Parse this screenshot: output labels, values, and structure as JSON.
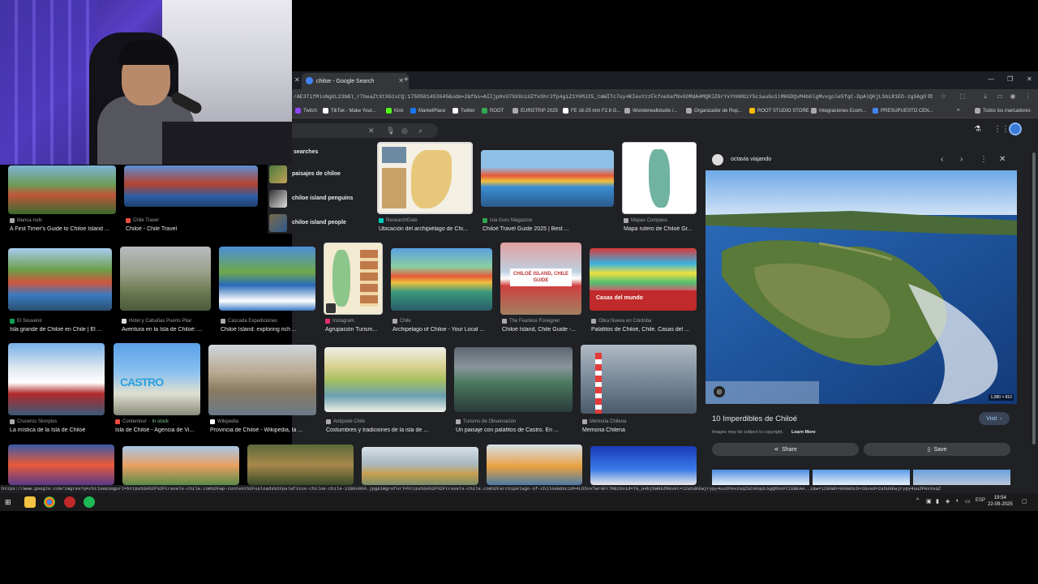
{
  "browser": {
    "tab_title": "chiloe - Google Search",
    "url": "/AE3TifMloNgUL23bBl_rTbeaZtXtX61sCQ:1758581453645&udm=2&fbs=AIIjpHxU7SXXniUZfeShr2fp4giZ1Y6MJ25_tmWITc7uy4KIeuYzzFkfneXafNx6OMdA4MQRJZ6rYxYhH0GiY5ciwuGo1lM6GDQvM4bGlgMvxgole5fqC-DpAlQKjLSbLR1EO-zg5AgO5T1YqoFZ2bS5fOu7lzsFwRco..."
  },
  "bookmarks": [
    {
      "label": "Twitch",
      "color": "#9146ff"
    },
    {
      "label": "TikTok - Make Your...",
      "color": "#ffffff"
    },
    {
      "label": "Kick",
      "color": "#53fc18"
    },
    {
      "label": "MarketPlace",
      "color": "#1877f2"
    },
    {
      "label": "Twitter",
      "color": "#ffffff"
    },
    {
      "label": "ROOT",
      "color": "#34a853"
    },
    {
      "label": "EUROTRIP 2025",
      "color": "#aaaaaa"
    },
    {
      "label": "FE 16-25 mm F2.8 G...",
      "color": "#ffffff"
    },
    {
      "label": "Wonderwallstudio /...",
      "color": "#aaaaaa"
    },
    {
      "label": "Organizador de Rop...",
      "color": "#aaaaaa"
    },
    {
      "label": "ROOT STUDIO STORE",
      "color": "#fbbc04"
    },
    {
      "label": "Integraciones Ecom...",
      "color": "#aaaaaa"
    },
    {
      "label": "PRESUPUESTO CEN...",
      "color": "#4285f4"
    }
  ],
  "all_bookmarks_label": "Todos los marcadores",
  "related": {
    "title": "searches",
    "items": [
      {
        "label": "paisajes de chiloe"
      },
      {
        "label": "chiloe island penguins"
      },
      {
        "label": "chiloe island people"
      }
    ]
  },
  "results": [
    {
      "source": "blanca rods",
      "title": "A First Timer's Guide to Chiloe Island ..."
    },
    {
      "source": "Chile Travel",
      "title": "Chiloé - Chile Travel"
    },
    {
      "source": "ResearchGate",
      "title": "Ubicación del archipiélago de Chi..."
    },
    {
      "source": "Isla Guru Magazine",
      "title": "Chiloé Travel Guide 2025 | Best ..."
    },
    {
      "source": "Mapas Compass",
      "title": "Mapa rutero de Chiloé Gr..."
    },
    {
      "source": "El Souvenir",
      "title": "Isla grande de Chiloé en Chile | El ..."
    },
    {
      "source": "Hotel y Cabañas Puerto Pilar",
      "title": "Aventura en la Isla de Chiloé: ..."
    },
    {
      "source": "Cascada Expediciones",
      "title": "Chiloé Island: exploring rich ..."
    },
    {
      "source": "Instagram",
      "title": "Agrupación Turism..."
    },
    {
      "source": "Chile",
      "title": "Archipelago of Chiloe - Your Local ..."
    },
    {
      "source": "The Fearless Foreigner",
      "title": "Chiloé Island, Chile Guide -..."
    },
    {
      "source": "Obra Nueva en Córdoba",
      "title": "Palafitos de Chiloé, Chile. Casas del ..."
    },
    {
      "source": "Cruceros Skorpios",
      "title": "La mística de la Isla de Chiloé"
    },
    {
      "source": "Contentour",
      "stock": "· In stock",
      "title": "Isla de Chiloé - Agencia de Vi..."
    },
    {
      "source": "Wikipedia",
      "title": "Provincia de Chiloé - Wikipedia, la ..."
    },
    {
      "source": "Antipode Chile",
      "title": "Costumbres y tradiciones de la isla de ..."
    },
    {
      "source": "Turismo de Observación",
      "title": "Un paisaje con palafitos de Castro. En ..."
    },
    {
      "source": "Memoria Chilena",
      "title": "Memoria Chilena"
    }
  ],
  "overlay_texts": {
    "chiloe_guide": "CHILOÉ ISLAND, CHILE GUIDE",
    "casas": "Casas del mundo",
    "castro": "CASTRO"
  },
  "preview": {
    "source": "octavia viajando",
    "size": "1,080 × 810",
    "title": "10 Imperdibles de Chiloé",
    "visit": "Visit",
    "copyright": "Images may be subject to copyright.",
    "learn_more": "Learn More",
    "share": "Share",
    "save": "Save"
  },
  "status_url": "https://www.google.com/imgres?q=chiloe&imgurl=https%3A%2F%2Ftravels-chile.com%2Fwp-content%2Fuploads%2Fpalafitos-chiloe-chile-1280x800.jpg&imgrefurl=https%3A%2F%2Ftravels-chile.com%2Farchipelago-of-chiloe&docid=4LD5xvTwrGFr7M&tbnid=TG_G4bjbWNkZM&vet=12ahUKEwjrypy4uu2PAxXsqZUCHXqULGgQM3oFCIEBEAA..i&w=1280&h=800&hcb=2&ved=2ahUKEwjrypy4uu2PAxXsqZUCHXqULGgQM3oFCIEBEAA",
  "taskbar": {
    "time": "19:54",
    "date": "22-09-2025",
    "lang": "ESP"
  }
}
